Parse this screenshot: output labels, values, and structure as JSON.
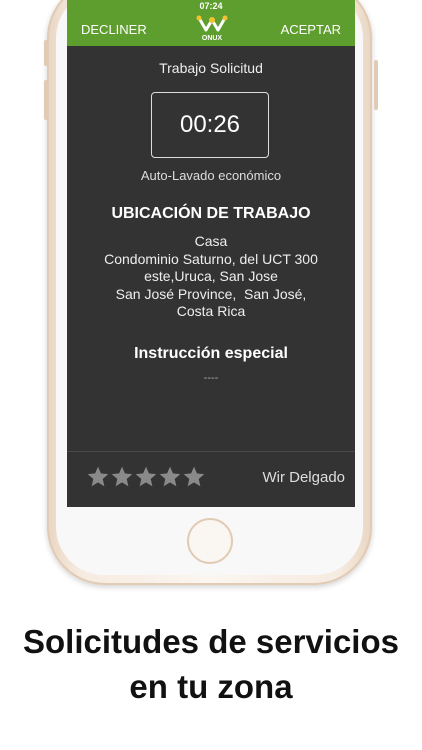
{
  "status_bar": {
    "time": "07:24"
  },
  "header": {
    "decline_label": "DECLINER",
    "accept_label": "ACEPTAR",
    "logo_text": "ONUX",
    "brand_color": "#5e9e2e"
  },
  "request": {
    "title": "Trabajo Solicitud",
    "timer": "00:26",
    "service": "Auto-Lavado económico"
  },
  "location": {
    "heading": "UBICACIÓN DE TRABAJO",
    "lines": [
      "Casa",
      "Condominio Saturno, del UCT 300",
      "este,Uruca, San Jose",
      "San José Province,  San José,",
      "Costa Rica"
    ]
  },
  "instructions": {
    "heading": "Instrucción especial",
    "text": "----"
  },
  "client": {
    "rating": 5,
    "max_rating": 5,
    "name": "Wir Delgado"
  },
  "caption": {
    "line1": "Solicitudes de servicios",
    "line2": "en tu zona"
  }
}
